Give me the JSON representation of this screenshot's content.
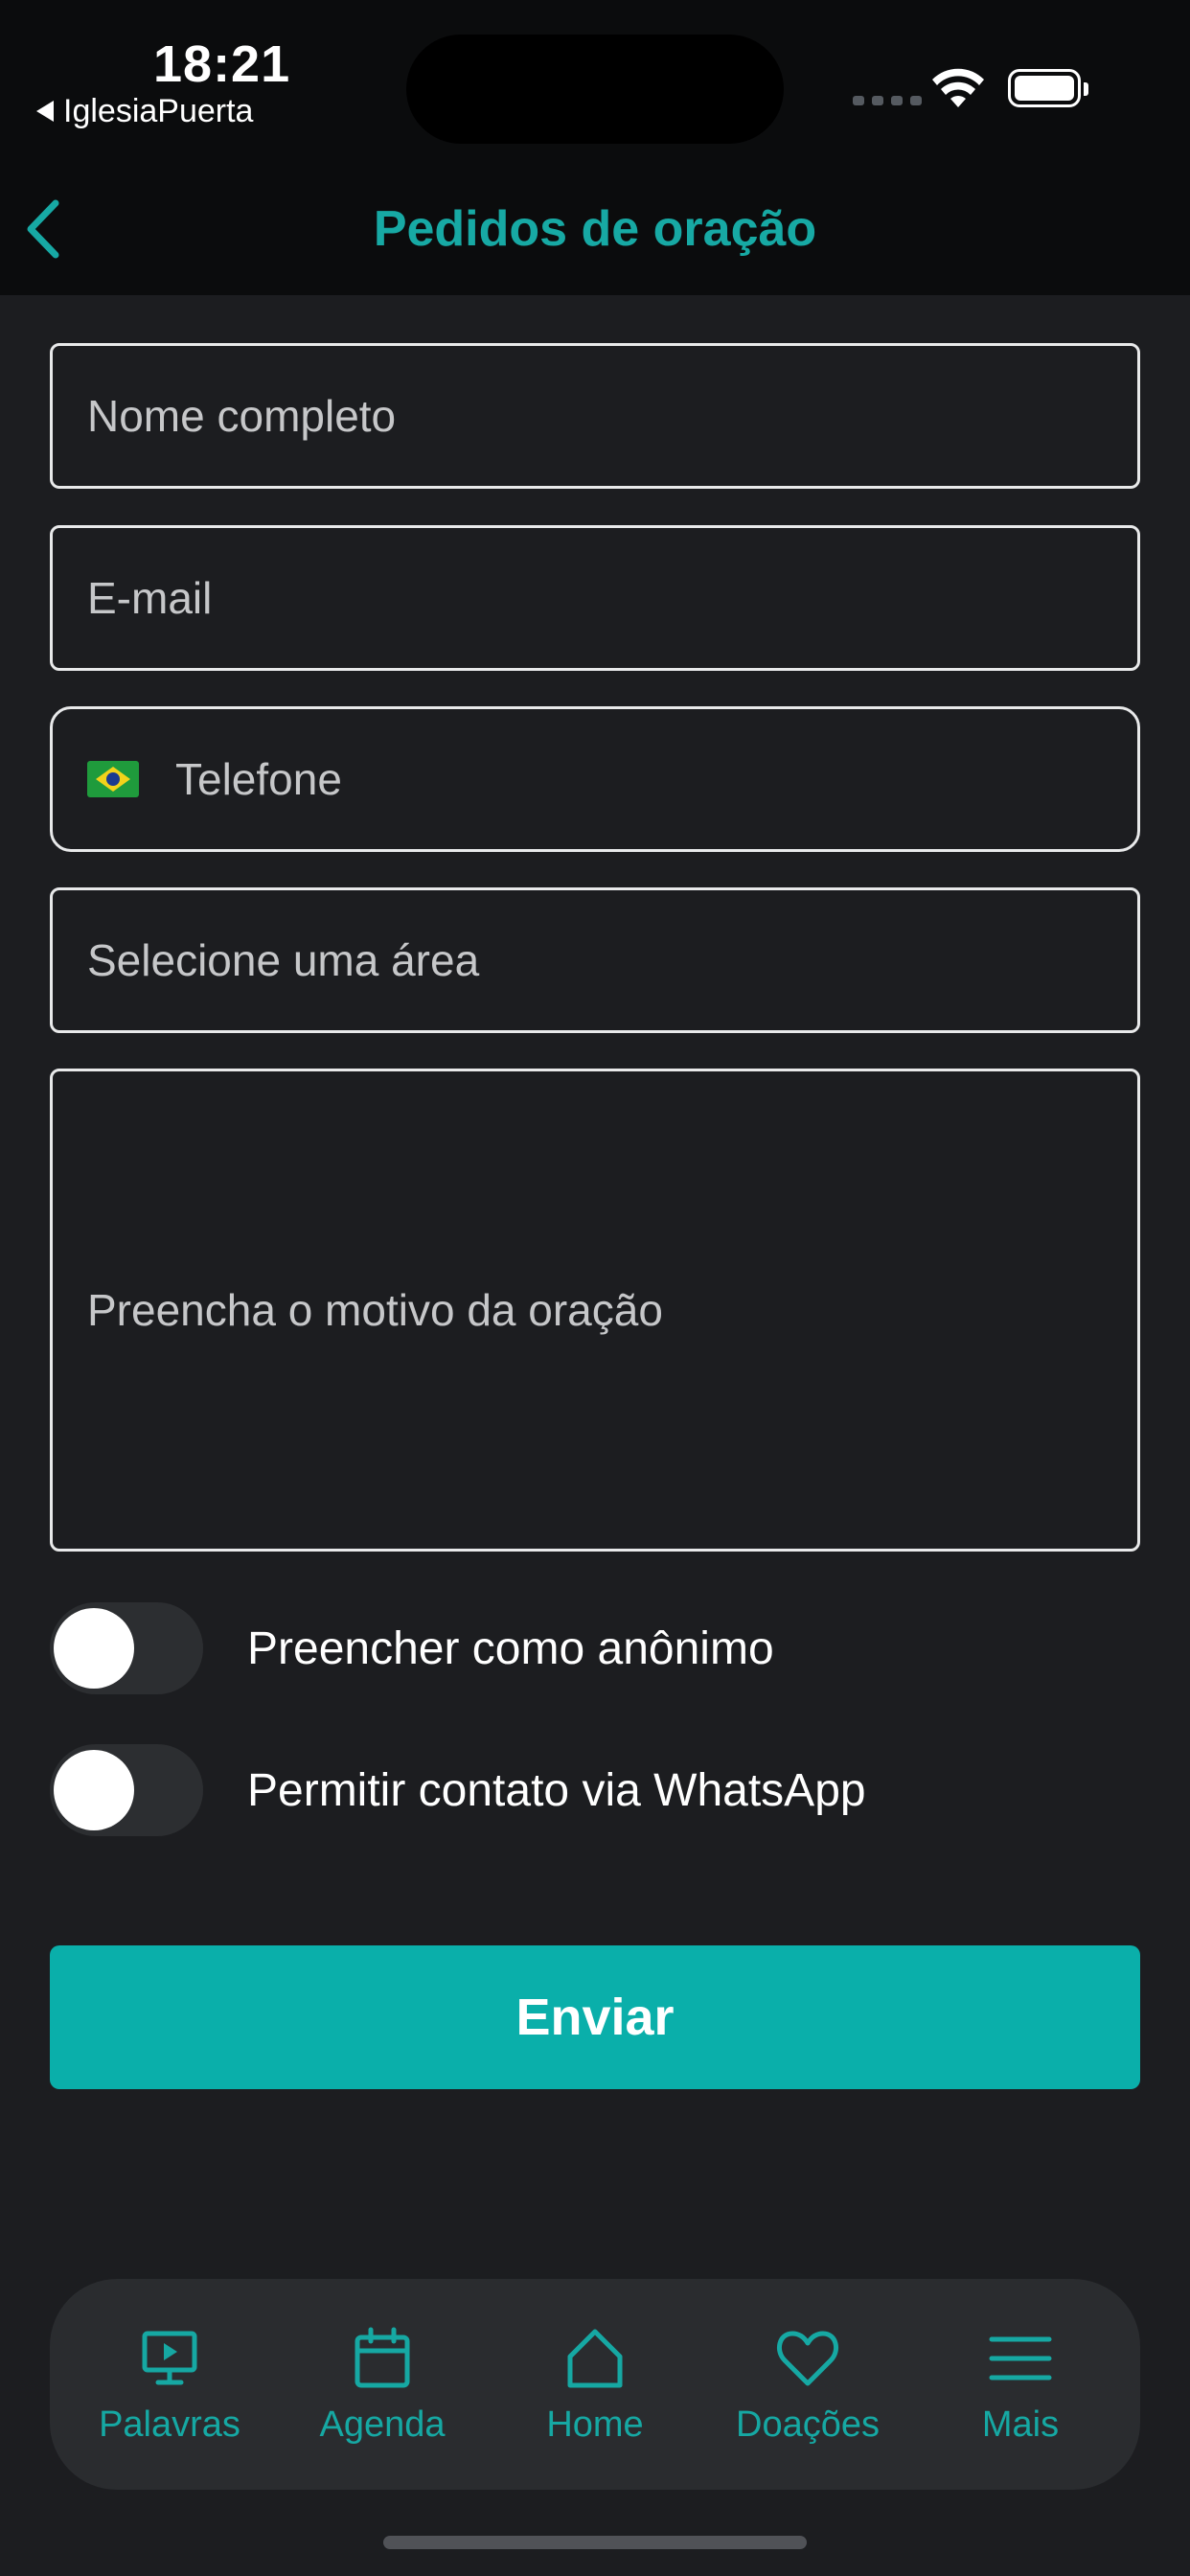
{
  "status_bar": {
    "time": "18:21",
    "back_app": "IglesiaPuerta"
  },
  "header": {
    "title": "Pedidos de oração"
  },
  "form": {
    "name_placeholder": "Nome completo",
    "email_placeholder": "E-mail",
    "phone_placeholder": "Telefone",
    "area_placeholder": "Selecione uma área",
    "reason_placeholder": "Preencha o motivo da oração"
  },
  "toggles": {
    "anonymous_label": "Preencher como anônimo",
    "anonymous_on": false,
    "whatsapp_label": "Permitir contato via WhatsApp",
    "whatsapp_on": false
  },
  "submit_label": "Enviar",
  "tabbar": {
    "items": [
      {
        "label": "Palavras",
        "icon": "presentation-screen-icon"
      },
      {
        "label": "Agenda",
        "icon": "calendar-icon"
      },
      {
        "label": "Home",
        "icon": "home-icon"
      },
      {
        "label": "Doações",
        "icon": "heart-icon"
      },
      {
        "label": "Mais",
        "icon": "menu-icon"
      }
    ]
  },
  "colors": {
    "accent": "#0aafaa",
    "background": "#1c1d20",
    "header_background": "#0b0c0d"
  }
}
